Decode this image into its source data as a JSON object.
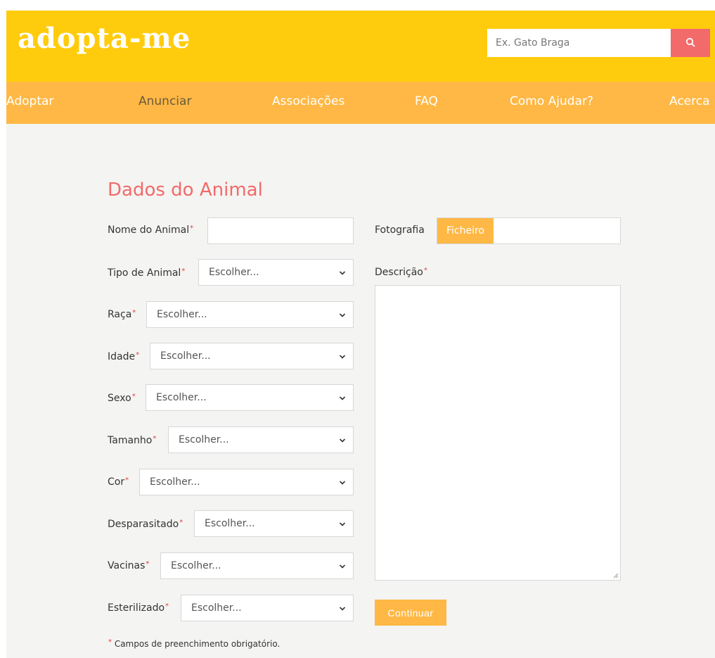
{
  "header": {
    "logo": "adopta-me",
    "search": {
      "placeholder": "Ex. Gato Braga",
      "icon": "search-icon"
    }
  },
  "nav": {
    "items": [
      "Adoptar",
      "Anunciar",
      "Associações",
      "FAQ",
      "Como Ajudar?",
      "Acerca"
    ],
    "active": "Anunciar"
  },
  "form": {
    "title": "Dados do Animal",
    "required_mark": "*",
    "name_label": "Nome do Animal",
    "name_value": "",
    "photo_label": "Fotografia",
    "file_button": "Ficheiro",
    "description_label": "Descrição",
    "description_value": "",
    "select_placeholder": "Escolher...",
    "fields": [
      {
        "label": "Tipo de Animal",
        "value": "Escolher..."
      },
      {
        "label": "Raça",
        "value": "Escolher..."
      },
      {
        "label": "Idade",
        "value": "Escolher..."
      },
      {
        "label": "Sexo",
        "value": "Escolher..."
      },
      {
        "label": "Tamanho",
        "value": "Escolher..."
      },
      {
        "label": "Cor",
        "value": "Escolher..."
      },
      {
        "label": "Desparasitado",
        "value": "Escolher..."
      },
      {
        "label": "Vacinas",
        "value": "Escolher..."
      },
      {
        "label": "Esterilizado",
        "value": "Escolher..."
      }
    ],
    "continue_button": "Continuar",
    "footnote": "Campos de preenchimento obrigatório."
  },
  "colors": {
    "header_bg": "#ffcc0d",
    "nav_bg": "#ffb845",
    "accent_red": "#f26a6a",
    "page_bg": "#f4f4f2"
  }
}
